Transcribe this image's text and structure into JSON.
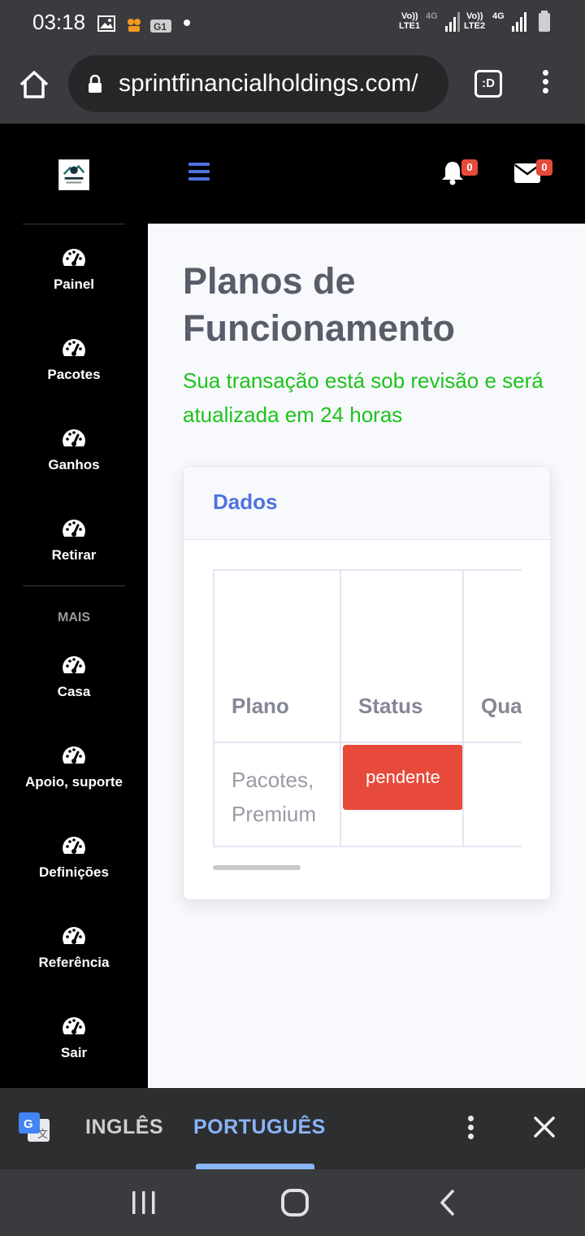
{
  "status_bar": {
    "time": "03:18",
    "sim1_top": "Vo))",
    "sim1_bottom": "LTE1",
    "sim1_net": "4G",
    "sim2_top": "Vo))",
    "sim2_bottom": "LTE2",
    "sim2_net": "4G"
  },
  "browser": {
    "url": "sprintfinancialholdings.com/",
    "tab_label": ":D"
  },
  "header": {
    "notifications_count": "0",
    "messages_count": "0"
  },
  "sidebar": {
    "items": [
      {
        "label": "Painel",
        "icon": "tachometer-icon"
      },
      {
        "label": "Pacotes",
        "icon": "tachometer-icon"
      },
      {
        "label": "Ganhos",
        "icon": "tachometer-icon"
      },
      {
        "label": "Retirar",
        "icon": "tachometer-icon"
      }
    ],
    "more_heading": "MAIS",
    "more_items": [
      {
        "label": "Casa",
        "icon": "tachometer-icon"
      },
      {
        "label": "Apoio, suporte",
        "icon": "tachometer-icon"
      },
      {
        "label": "Definições",
        "icon": "tachometer-icon"
      },
      {
        "label": "Referência",
        "icon": "tachometer-icon"
      },
      {
        "label": "Sair",
        "icon": "tachometer-icon"
      }
    ]
  },
  "main": {
    "title": "Planos de Funcionamento",
    "notice": "Sua transação está sob revisão e será atualizada em 24 horas",
    "card": {
      "title": "Dados",
      "table": {
        "headers": [
          "Plano",
          "Status",
          "Qua"
        ],
        "rows": [
          {
            "plan": "Pacotes, Premium",
            "status": "pendente",
            "qty": ""
          }
        ]
      }
    }
  },
  "translate_bar": {
    "source_language": "INGLÊS",
    "target_language": "PORTUGUÊS"
  },
  "colors": {
    "accent": "#4e73df",
    "notice_green": "#1cc31c",
    "danger": "#e74a3b",
    "sidebar_bg": "#000000",
    "translate_active": "#8ab4f8"
  }
}
